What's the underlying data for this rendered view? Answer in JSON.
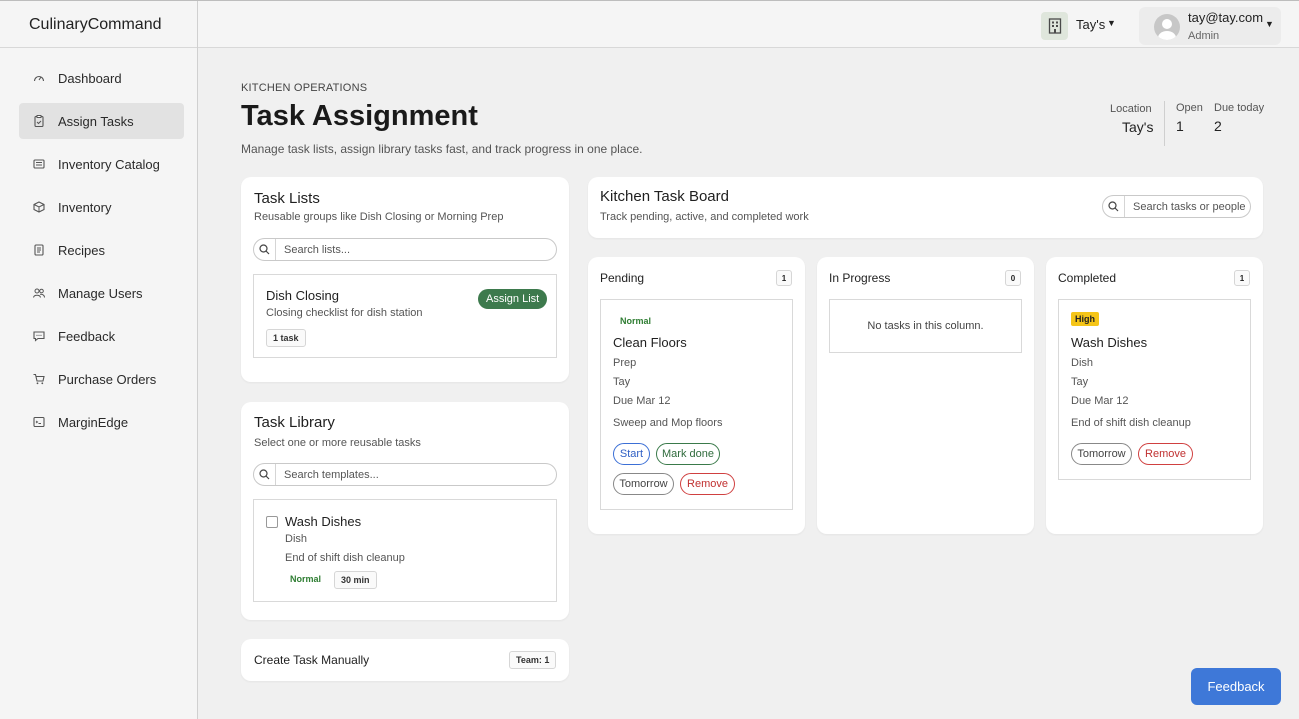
{
  "app": {
    "brand": "CulinaryCommand"
  },
  "topbar": {
    "location_name": "Tay's",
    "user_email": "tay@tay.com",
    "user_role": "Admin"
  },
  "sidebar": {
    "items": [
      {
        "label": "Dashboard",
        "icon": "gauge-icon",
        "active": false
      },
      {
        "label": "Assign Tasks",
        "icon": "clipboard-icon",
        "active": true
      },
      {
        "label": "Inventory Catalog",
        "icon": "list-icon",
        "active": false
      },
      {
        "label": "Inventory",
        "icon": "box-icon",
        "active": false
      },
      {
        "label": "Recipes",
        "icon": "document-icon",
        "active": false
      },
      {
        "label": "Manage Users",
        "icon": "users-icon",
        "active": false
      },
      {
        "label": "Feedback",
        "icon": "chat-icon",
        "active": false
      },
      {
        "label": "Purchase Orders",
        "icon": "cart-icon",
        "active": false
      },
      {
        "label": "MarginEdge",
        "icon": "terminal-icon",
        "active": false
      }
    ]
  },
  "header": {
    "eyebrow": "KITCHEN OPERATIONS",
    "title": "Task Assignment",
    "subtitle": "Manage task lists, assign library tasks fast, and track progress in one place.",
    "stats": {
      "location_label": "Location",
      "location_value": "Tay's",
      "open_label": "Open",
      "open_value": "1",
      "due_label": "Due today",
      "due_value": "2"
    }
  },
  "task_lists": {
    "title": "Task Lists",
    "subtitle": "Reusable groups like Dish Closing or Morning Prep",
    "search_placeholder": "Search lists...",
    "items": [
      {
        "name": "Dish Closing",
        "description": "Closing checklist for dish station",
        "count": "1 task",
        "action": "Assign List"
      }
    ]
  },
  "task_library": {
    "title": "Task Library",
    "subtitle": "Select one or more reusable tasks",
    "search_placeholder": "Search templates...",
    "items": [
      {
        "name": "Wash Dishes",
        "station": "Dish",
        "description": "End of shift dish cleanup",
        "priority": "Normal",
        "duration": "30 min"
      }
    ]
  },
  "create_manual": {
    "title": "Create Task Manually",
    "team": "Team: 1"
  },
  "board": {
    "title": "Kitchen Task Board",
    "subtitle": "Track pending, active, and completed work",
    "search_placeholder": "Search tasks or people",
    "columns": [
      {
        "title": "Pending",
        "count": "1",
        "task": {
          "priority": "Normal",
          "name": "Clean Floors",
          "station": "Prep",
          "assignee": "Tay",
          "due": "Due Mar 12",
          "notes": "Sweep and Mop floors",
          "actions": [
            "Start",
            "Mark done",
            "Tomorrow",
            "Remove"
          ]
        }
      },
      {
        "title": "In Progress",
        "count": "0",
        "empty": "No tasks in this column."
      },
      {
        "title": "Completed",
        "count": "1",
        "task": {
          "priority": "High",
          "name": "Wash Dishes",
          "station": "Dish",
          "assignee": "Tay",
          "due": "Due Mar 12",
          "notes": "End of shift dish cleanup",
          "actions": [
            "Tomorrow",
            "Remove"
          ]
        }
      }
    ]
  },
  "feedback_button": "Feedback",
  "colors": {
    "accent_green": "#3d7a4d",
    "accent_blue": "#3e78d8",
    "high_priority": "#f5c518",
    "danger": "#d04040"
  }
}
